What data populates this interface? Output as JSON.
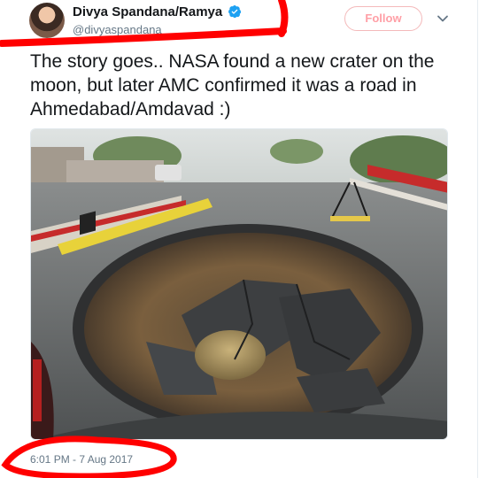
{
  "author": {
    "name": "Divya Spandana/Ramya",
    "handle": "@divyaspandana"
  },
  "follow_button": {
    "label": "Follow"
  },
  "tweet": {
    "text": "The story goes.. NASA found a new crater on the moon, but later AMC confirmed it was a road in Ahmedabad/Amdavad :)"
  },
  "timestamp": "6:01 PM - 7 Aug 2017",
  "colors": {
    "follow_border": "#f4b9ba",
    "follow_text": "#ff9fa6",
    "verified_blue": "#1da1f2",
    "annotation_red": "#ff0000",
    "secondary_text": "#657786"
  },
  "icons": {
    "verified": "verified-badge-icon",
    "menu": "chevron-down-icon"
  }
}
